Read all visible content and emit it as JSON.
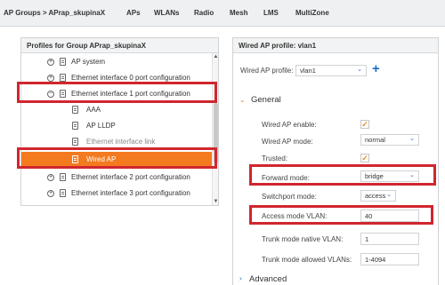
{
  "topbar": {
    "breadcrumb": "AP Groups > APrap_skupinaX",
    "tabs": [
      "APs",
      "WLANs",
      "Radio",
      "Mesh",
      "LMS",
      "MultiZone"
    ]
  },
  "left_panel": {
    "title": "Profiles for Group APrap_skupinaX",
    "items": [
      {
        "label": "AP system"
      },
      {
        "label": "Ethernet interface 0 port configuration"
      },
      {
        "label": "Ethernet interface 1 port configuration"
      },
      {
        "label": "AAA"
      },
      {
        "label": "AP LLDP"
      },
      {
        "label": "Ethernet interface link"
      },
      {
        "label": "Wired AP"
      },
      {
        "label": "Ethernet interface 2 port configuration"
      },
      {
        "label": "Ethernet interface 3 port configuration"
      }
    ]
  },
  "right_panel": {
    "title": "Wired AP profile: vlan1",
    "profile_label": "Wired AP profile:",
    "profile_value": "vlan1",
    "general_title": "General",
    "fields": {
      "enable_label": "Wired AP enable:",
      "mode_label": "Wired AP mode:",
      "mode_value": "normal",
      "trusted_label": "Trusted:",
      "forward_label": "Forward mode:",
      "forward_value": "bridge",
      "switchport_label": "Switchport mode:",
      "switchport_value": "access",
      "access_vlan_label": "Access mode VLAN:",
      "access_vlan_value": "40",
      "native_vlan_label": "Trunk mode native VLAN:",
      "native_vlan_value": "1",
      "allowed_vlans_label": "Trunk mode allowed VLANs:",
      "allowed_vlans_value": "1-4094"
    },
    "advanced_title": "Advanced"
  },
  "colors": {
    "selected": "#f47a20",
    "highlight": "#d0262e",
    "accent": "#1f6fc5"
  }
}
